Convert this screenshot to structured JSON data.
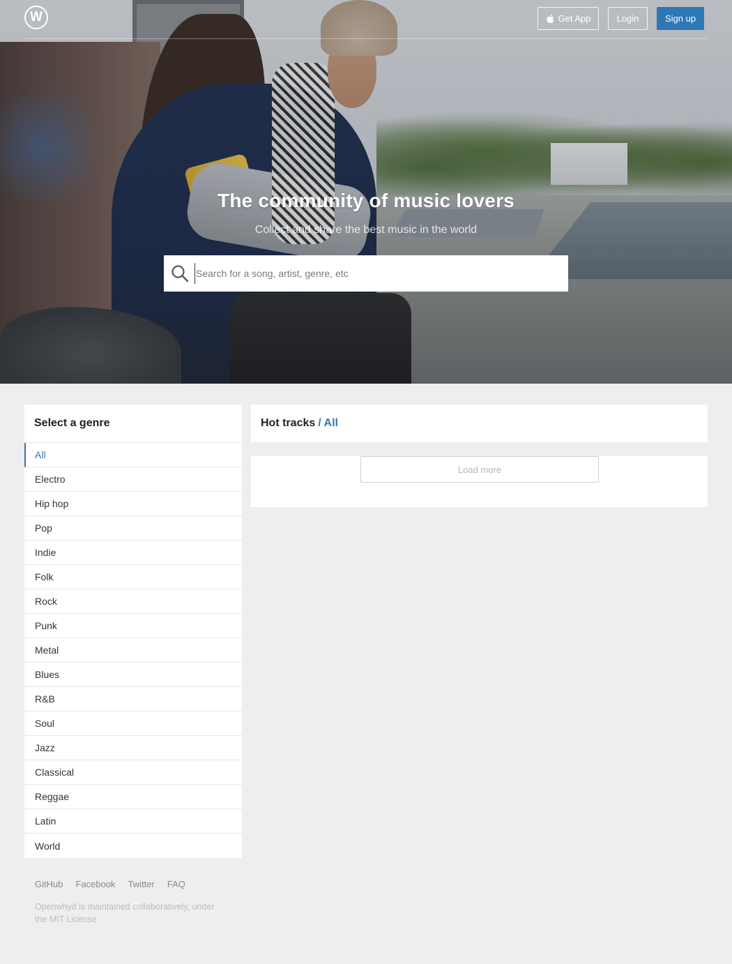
{
  "brand": {
    "logo_letter": "W",
    "accent_color": "#2f78b6"
  },
  "nav": {
    "get_app_label": "Get App",
    "login_label": "Login",
    "signup_label": "Sign up"
  },
  "hero": {
    "title": "The community of music lovers",
    "subtitle": "Collect and share the best music in the world",
    "search_placeholder": "Search for a song, artist, genre, etc"
  },
  "sidebar": {
    "title": "Select a genre",
    "genres": [
      "All",
      "Electro",
      "Hip hop",
      "Pop",
      "Indie",
      "Folk",
      "Rock",
      "Punk",
      "Metal",
      "Blues",
      "R&B",
      "Soul",
      "Jazz",
      "Classical",
      "Reggae",
      "Latin",
      "World"
    ],
    "selected": "All"
  },
  "main": {
    "title": "Hot tracks",
    "crumb": "/ All",
    "load_more_label": "Load more"
  },
  "footer": {
    "links": [
      "GitHub",
      "Facebook",
      "Twitter",
      "FAQ"
    ],
    "note": "Openwhyd is maintained collaboratively, under the MIT License"
  },
  "icons": {
    "search": "search-icon",
    "apple": "apple-icon"
  }
}
